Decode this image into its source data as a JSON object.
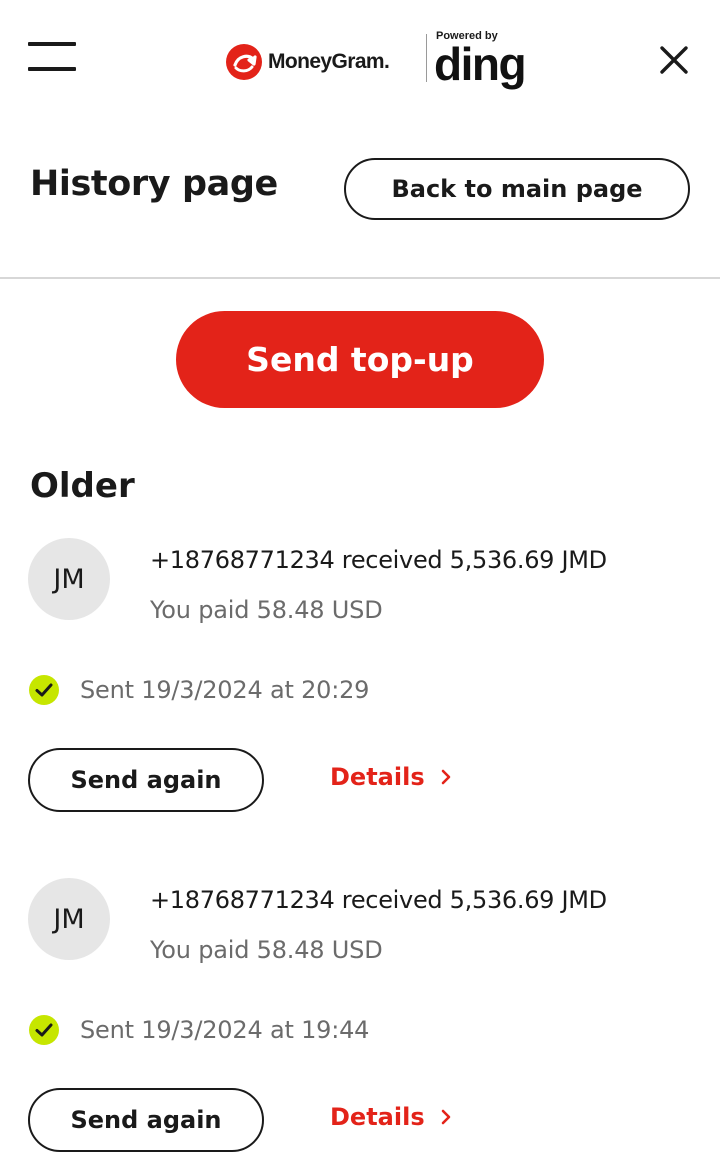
{
  "header": {
    "brand_name": "MoneyGram.",
    "powered_by": "Powered by",
    "partner_name": "ding",
    "brand_color": "#e32319",
    "icons": {
      "menu": "hamburger-menu-icon",
      "close": "close-icon"
    }
  },
  "page": {
    "title": "History page",
    "back_label": "Back to main page",
    "send_topup_label": "Send top-up",
    "section_title": "Older"
  },
  "transactions": [
    {
      "initials": "JM",
      "summary": "+18768771234 received 5,536.69 JMD",
      "paid": "You paid 58.48 USD",
      "status": "Sent 19/3/2024 at 20:29",
      "status_color": "#c6e600",
      "send_again_label": "Send again",
      "details_label": "Details"
    },
    {
      "initials": "JM",
      "summary": "+18768771234 received 5,536.69 JMD",
      "paid": "You paid 58.48 USD",
      "status": "Sent 19/3/2024 at 19:44",
      "status_color": "#c6e600",
      "send_again_label": "Send again",
      "details_label": "Details"
    }
  ]
}
